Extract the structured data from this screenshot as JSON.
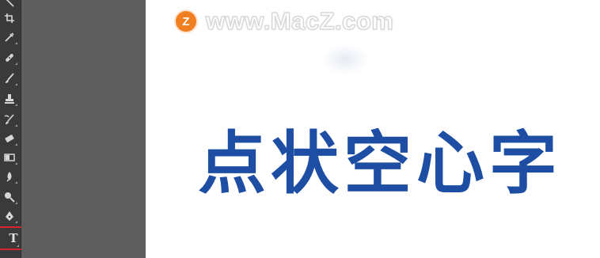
{
  "canvas": {
    "watermark": {
      "logo_letter": "Z",
      "text": "www.MacZ.com"
    },
    "headline": "点状空心字"
  },
  "toolbar": {
    "tools": [
      {
        "name": "move-tool",
        "icon": "move-icon"
      },
      {
        "name": "crop-tool",
        "icon": "crop-icon"
      },
      {
        "name": "eyedropper-tool",
        "icon": "eyedropper-icon"
      },
      {
        "name": "healing-brush-tool",
        "icon": "bandage-icon"
      },
      {
        "name": "brush-tool",
        "icon": "brush-icon"
      },
      {
        "name": "clone-stamp-tool",
        "icon": "stamp-icon"
      },
      {
        "name": "history-brush-tool",
        "icon": "history-brush-icon"
      },
      {
        "name": "eraser-tool",
        "icon": "eraser-icon"
      },
      {
        "name": "gradient-tool",
        "icon": "gradient-icon"
      },
      {
        "name": "blur-tool",
        "icon": "blur-icon"
      },
      {
        "name": "dodge-tool",
        "icon": "dodge-icon"
      },
      {
        "name": "pen-tool",
        "icon": "pen-icon"
      },
      {
        "name": "type-tool",
        "icon": "type-icon"
      }
    ],
    "type_tool_glyph": "T",
    "selected_tool": "type-tool",
    "highlight_color": "#d9222a"
  },
  "colors": {
    "headline": "#1d4ea3",
    "watermark_logo": "#f07f22",
    "workspace": "#5e5e5e",
    "toolbar": "#3a3a3a"
  }
}
